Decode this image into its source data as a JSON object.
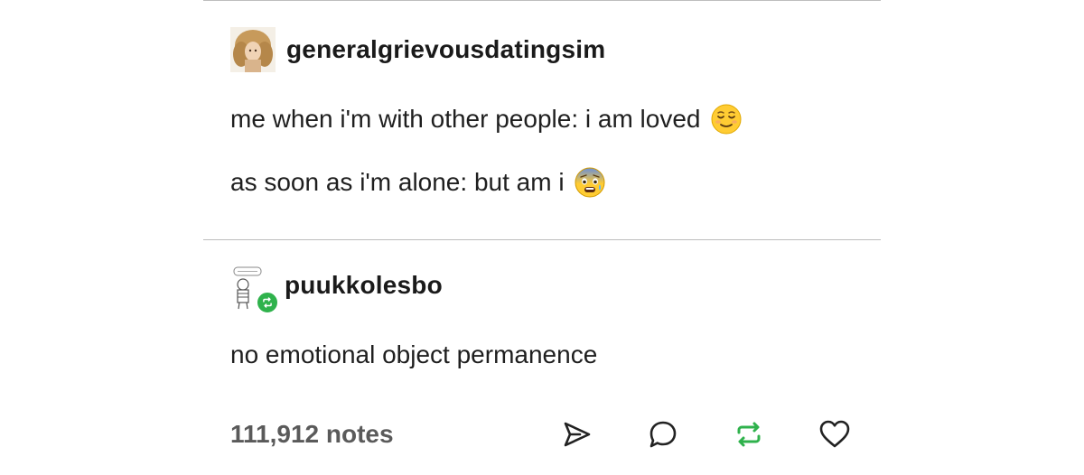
{
  "posts": [
    {
      "username": "generalgrievousdatingsim",
      "lines": [
        {
          "text": "me when i'm with other people: i am loved",
          "emoji": "relieved-face-emoji"
        },
        {
          "text": "as soon as i'm alone: but am i",
          "emoji": "fearful-face-emoji"
        }
      ]
    },
    {
      "username": "puukkolesbo",
      "reblog_badge": "reblog-icon",
      "lines": [
        {
          "text": "no emotional object permanence"
        }
      ]
    }
  ],
  "footer": {
    "notes": "111,912 notes",
    "actions": [
      "share-icon",
      "reply-icon",
      "reblog-icon",
      "like-icon"
    ]
  },
  "colors": {
    "divider": "#bdbdbd",
    "reblog_green": "#2fb24c",
    "notes_gray": "#5a5a5a"
  }
}
